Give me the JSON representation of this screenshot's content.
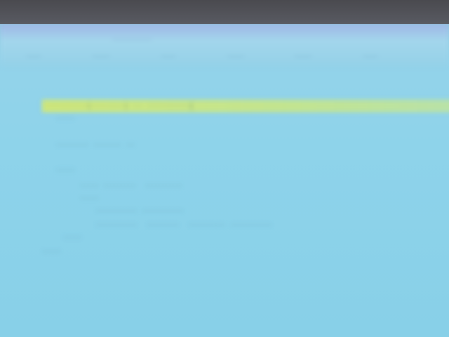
{
  "window": {
    "title": "················"
  },
  "menu": [
    "······",
    "·······",
    "······",
    "·······",
    "·······",
    "······"
  ],
  "code_lines": [
    {
      "indent": 60,
      "text": "·········(·······) ·· ·········{",
      "highlight": true
    },
    {
      "indent": 80,
      "text": "····",
      "highlight": false
    },
    {
      "indent": 80,
      "text": "······· ······ ··",
      "highlight": false
    },
    {
      "indent": 80,
      "text": "····",
      "highlight": false
    },
    {
      "indent": 114,
      "text": "···· ·······  ········",
      "highlight": false
    },
    {
      "indent": 114,
      "text": "····",
      "highlight": false
    },
    {
      "indent": 136,
      "text": "········· ·········",
      "highlight": false
    },
    {
      "indent": 136,
      "text": "·········  ·······  ········ ·········",
      "highlight": false
    },
    {
      "indent": 90,
      "text": "····",
      "highlight": false
    },
    {
      "indent": 60,
      "text": "····",
      "highlight": false
    }
  ],
  "colors": {
    "screen": "#8ed3ea",
    "highlight": "#cfe77a",
    "code_text": "#4a8ea7"
  }
}
